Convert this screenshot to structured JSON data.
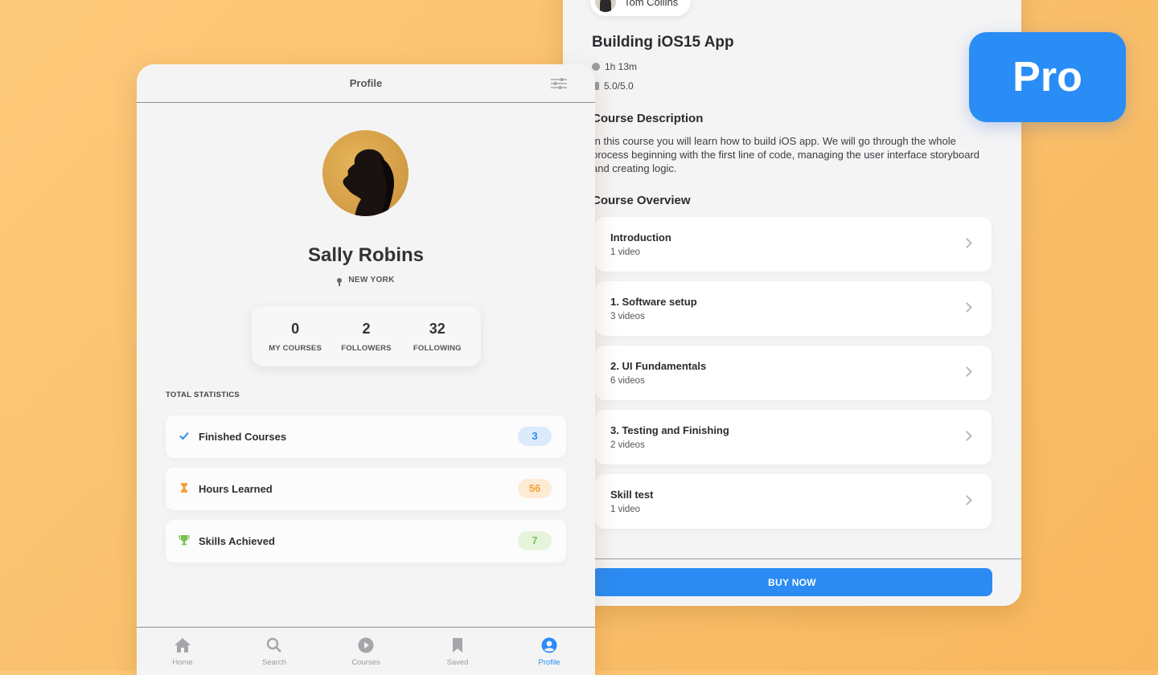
{
  "colors": {
    "accent": "#2a8cf5",
    "background": "#f9c06b",
    "finished": "#2a8cf5",
    "hours": "#f5a23b",
    "skills": "#7cc052"
  },
  "course": {
    "author": "Tom Collins",
    "title": "Building iOS15 App",
    "duration": "1h 13m",
    "rating": "5.0/5.0",
    "description_heading": "Course Description",
    "description": "In this course you will learn how to build iOS app. We will go through the whole process beginning with the first line of code, managing the user interface storyboard and creating logic.",
    "overview_heading": "Course Overview",
    "sections": [
      {
        "title": "Introduction",
        "sub": "1 video"
      },
      {
        "title": "1. Software setup",
        "sub": "3 videos"
      },
      {
        "title": "2. UI Fundamentals",
        "sub": "6 videos"
      },
      {
        "title": "3. Testing and Finishing",
        "sub": "2 videos"
      },
      {
        "title": "Skill test",
        "sub": "1 video"
      }
    ],
    "buy_label": "BUY NOW"
  },
  "pro_badge": "Pro",
  "profile": {
    "nav_title": "Profile",
    "name": "Sally Robins",
    "location": "NEW YORK",
    "stats": [
      {
        "value": "0",
        "label": "MY COURSES"
      },
      {
        "value": "2",
        "label": "FOLLOWERS"
      },
      {
        "value": "32",
        "label": "FOLLOWING"
      }
    ],
    "total_heading": "TOTAL STATISTICS",
    "rows": [
      {
        "icon": "checkmark-icon",
        "label": "Finished Courses",
        "value": "3"
      },
      {
        "icon": "hourglass-icon",
        "label": "Hours Learned",
        "value": "56"
      },
      {
        "icon": "trophy-icon",
        "label": "Skills Achieved",
        "value": "7"
      }
    ],
    "tabs": [
      {
        "icon": "home-icon",
        "label": "Home",
        "active": false
      },
      {
        "icon": "search-icon",
        "label": "Search",
        "active": false
      },
      {
        "icon": "play-icon",
        "label": "Courses",
        "active": false
      },
      {
        "icon": "bookmark-icon",
        "label": "Saved",
        "active": false
      },
      {
        "icon": "user-icon",
        "label": "Profile",
        "active": true
      }
    ]
  }
}
